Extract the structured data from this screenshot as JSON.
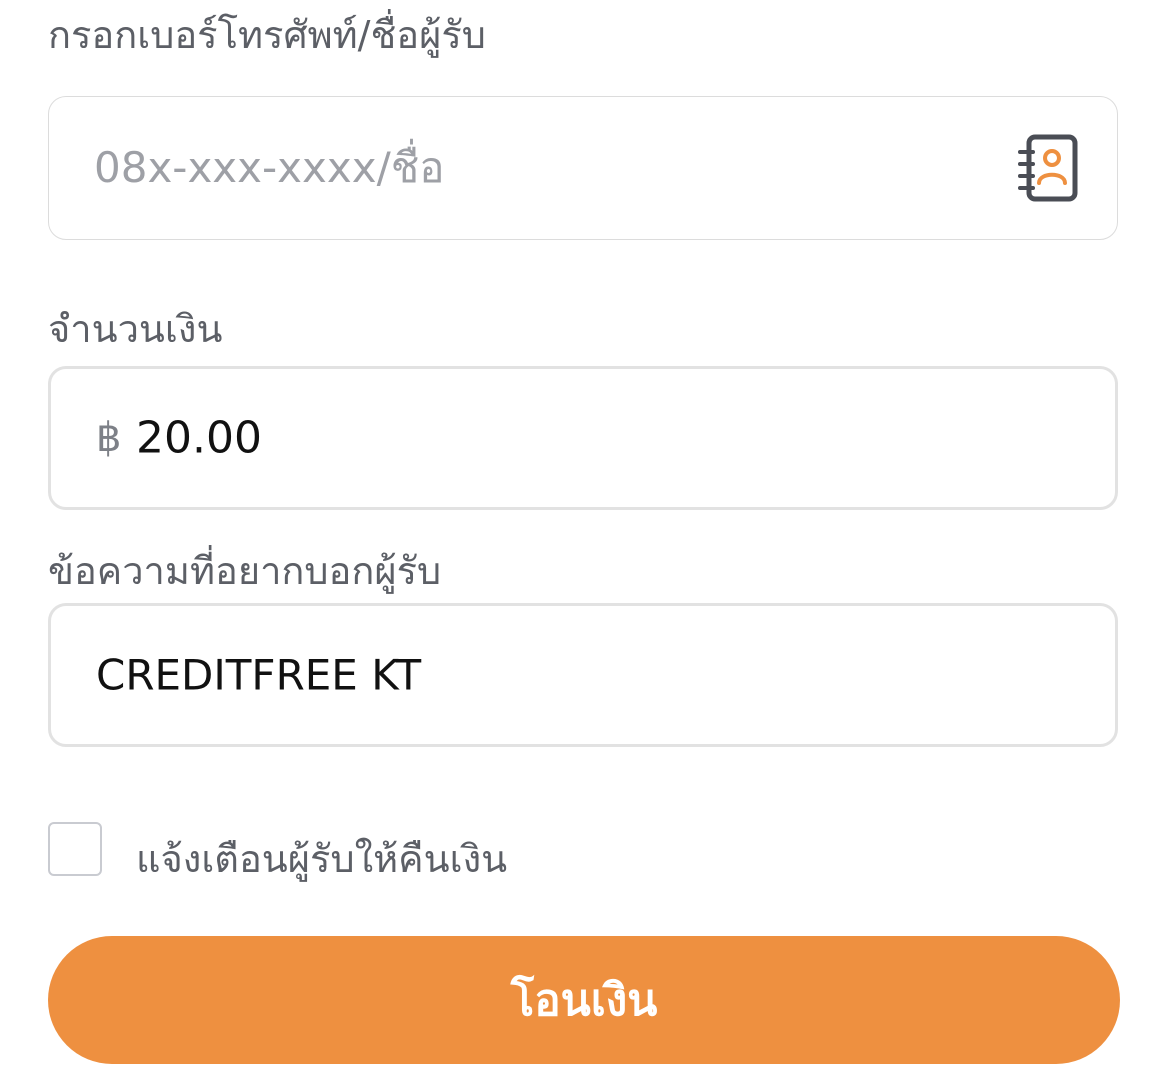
{
  "recipient": {
    "label": "กรอกเบอร์โทรศัพท์/ชื่อผู้รับ",
    "placeholder": "08x-xxx-xxxx/ชื่อ",
    "value": "",
    "contact_icon": "contact-book-icon"
  },
  "amount": {
    "label": "จำนวนเงิน",
    "currency_symbol": "฿",
    "value": "20.00"
  },
  "message": {
    "label": "ข้อความที่อยากบอกผู้รับ",
    "value": "CREDITFREE KT"
  },
  "refund_reminder": {
    "label": "แจ้งเตือนผู้รับให้คืนเงิน",
    "checked": false
  },
  "submit": {
    "label": "โอนเงิน"
  },
  "colors": {
    "accent": "#EE9040",
    "label_text": "#5C5F66",
    "placeholder_text": "#9EA0A6",
    "icon_dark": "#4A4D55"
  }
}
